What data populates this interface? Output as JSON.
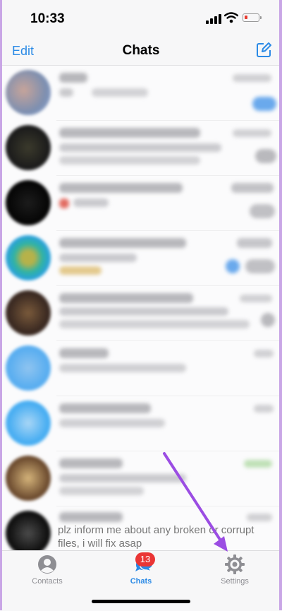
{
  "status": {
    "time": "10:33"
  },
  "nav": {
    "edit_label": "Edit",
    "title": "Chats",
    "compose_icon": "compose-icon"
  },
  "chats": {
    "last_preview": "plz inform me about any broken or corrupt files, i will fix asap"
  },
  "tabs": [
    {
      "label": "Contacts",
      "icon": "person-icon",
      "active": false
    },
    {
      "label": "Chats",
      "icon": "chat-bubbles-icon",
      "active": true,
      "badge": "13"
    },
    {
      "label": "Settings",
      "icon": "gear-icon",
      "active": false
    }
  ],
  "colors": {
    "accent": "#2b8ae6",
    "badge": "#ea3535",
    "annotation_arrow": "#9b4de3",
    "inactive": "#8e8e93"
  }
}
